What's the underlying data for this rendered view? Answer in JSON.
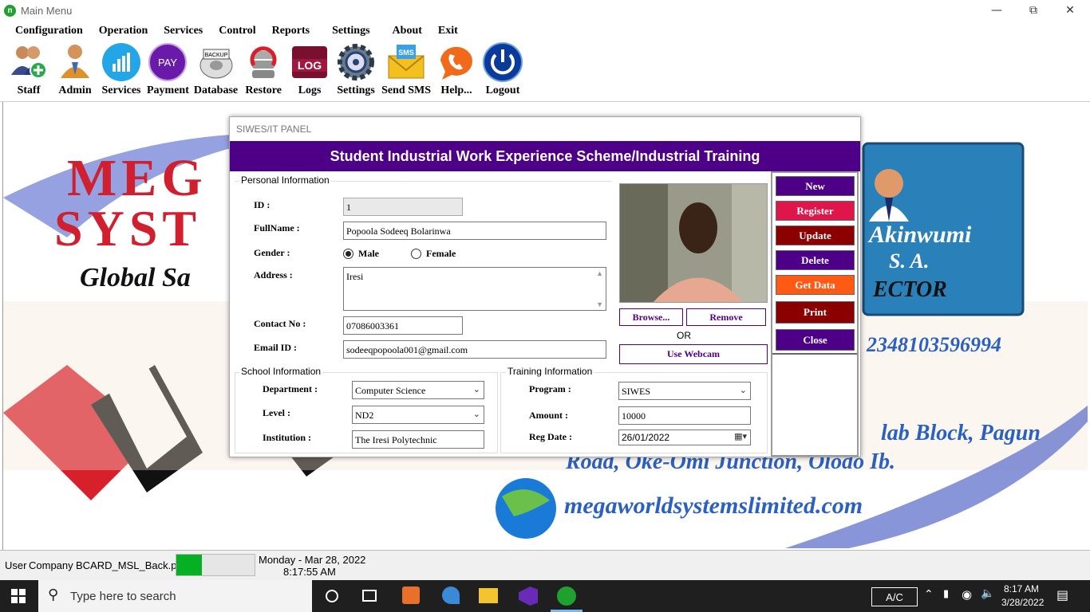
{
  "window": {
    "title": "Main Menu",
    "logo_letter": "n"
  },
  "menu": [
    "Configuration",
    "Operation",
    "Services",
    "Control",
    "Reports",
    "Settings",
    "About",
    "Exit"
  ],
  "toolbar": {
    "staff": "Staff",
    "admin": "Admin",
    "services": "Services",
    "payment": "Payment",
    "database": "Database",
    "restore": "Restore",
    "logs": "Logs",
    "settings": "Settings",
    "sms": "Send SMS",
    "help": "Help...",
    "logout": "Logout",
    "pay_icon_text": "PAY",
    "log_icon_text": "LOG",
    "backup_icon_text": "BACKUP",
    "sms_icon_text": "SMS"
  },
  "background": {
    "brand1": "MEG",
    "brand2": "SYST",
    "tagline": "Global Sa",
    "name": "Akinwumi",
    "initials": "S. A.",
    "role": "ECTOR",
    "phone": "2348103596994",
    "addr1": "lab Block, Pagun",
    "addr2": "Road, Oke-Omi Junction, Olodo Ib.",
    "website": "megaworldsystemslimited.com"
  },
  "dialog": {
    "title": "SIWES/IT PANEL",
    "banner": "Student Industrial Work Experience Scheme/Industrial Training",
    "personal": {
      "group": "Personal Information",
      "id_label": "ID :",
      "id": "1",
      "fullname_label": "FullName :",
      "fullname": "Popoola Sodeeq Bolarinwa",
      "gender_label": "Gender :",
      "male": "Male",
      "female": "Female",
      "address_label": "Address :",
      "address": "Iresi",
      "contact_label": "Contact No :",
      "contact": "07086003361",
      "email_label": "Email ID :",
      "email": "sodeeqpopoola001@gmail.com"
    },
    "photo": {
      "browse": "Browse...",
      "remove": "Remove",
      "or": "OR",
      "webcam": "Use Webcam"
    },
    "school": {
      "group": "School Information",
      "dept_label": "Department :",
      "dept": "Computer Science",
      "level_label": "Level :",
      "level": "ND2",
      "inst_label": "Institution :",
      "inst": "The Iresi Polytechnic"
    },
    "training": {
      "group": "Training Information",
      "program_label": "Program :",
      "program": "SIWES",
      "amount_label": "Amount :",
      "amount": "10000",
      "regdate_label": "Reg Date :",
      "regdate": "26/01/2022"
    },
    "actions": {
      "new": "New",
      "register": "Register",
      "update": "Update",
      "delete": "Delete",
      "get_data": "Get Data",
      "print": "Print",
      "close": "Close"
    },
    "colors": {
      "purple": "#4d0087",
      "crimson": "#e0154a",
      "maroon": "#8b0000",
      "orange": "#ff5a14"
    }
  },
  "status": {
    "user": "User",
    "company": "Company",
    "file": "BCARD_MSL_Back.png",
    "progress": 0.33,
    "date": "Monday - Mar 28, 2022",
    "time": "8:17:55 AM"
  },
  "taskbar": {
    "search_placeholder": "Type here to search",
    "ac": "A/C",
    "time": "8:17 AM",
    "date": "3/28/2022"
  }
}
